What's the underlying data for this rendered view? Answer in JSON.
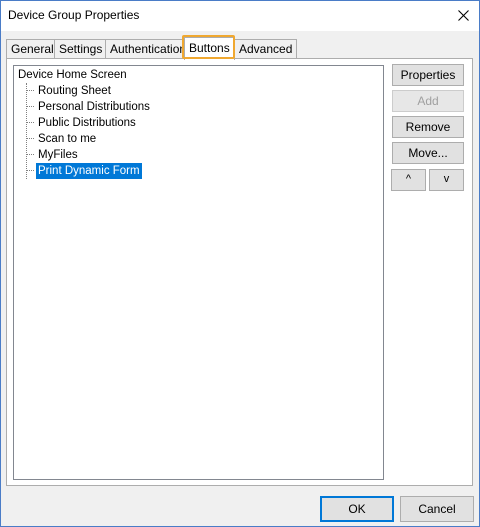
{
  "window": {
    "title": "Device Group Properties",
    "close_icon": "close-icon"
  },
  "tabs": [
    {
      "label": "General",
      "selected": false
    },
    {
      "label": "Settings",
      "selected": false
    },
    {
      "label": "Authentication",
      "selected": false
    },
    {
      "label": "Buttons",
      "selected": true
    },
    {
      "label": "Advanced",
      "selected": false
    }
  ],
  "tree": {
    "root": "Device Home Screen",
    "children": [
      {
        "label": "Routing Sheet",
        "selected": false
      },
      {
        "label": "Personal Distributions",
        "selected": false
      },
      {
        "label": "Public Distributions",
        "selected": false
      },
      {
        "label": "Scan to me",
        "selected": false
      },
      {
        "label": "MyFiles",
        "selected": false
      },
      {
        "label": "Print Dynamic Form",
        "selected": true
      }
    ]
  },
  "side_buttons": {
    "properties": "Properties",
    "add": "Add",
    "remove": "Remove",
    "move": "Move...",
    "up": "^",
    "down": "v"
  },
  "footer": {
    "ok": "OK",
    "cancel": "Cancel"
  },
  "colors": {
    "highlight": "#f0a830",
    "selection": "#0078d7"
  }
}
